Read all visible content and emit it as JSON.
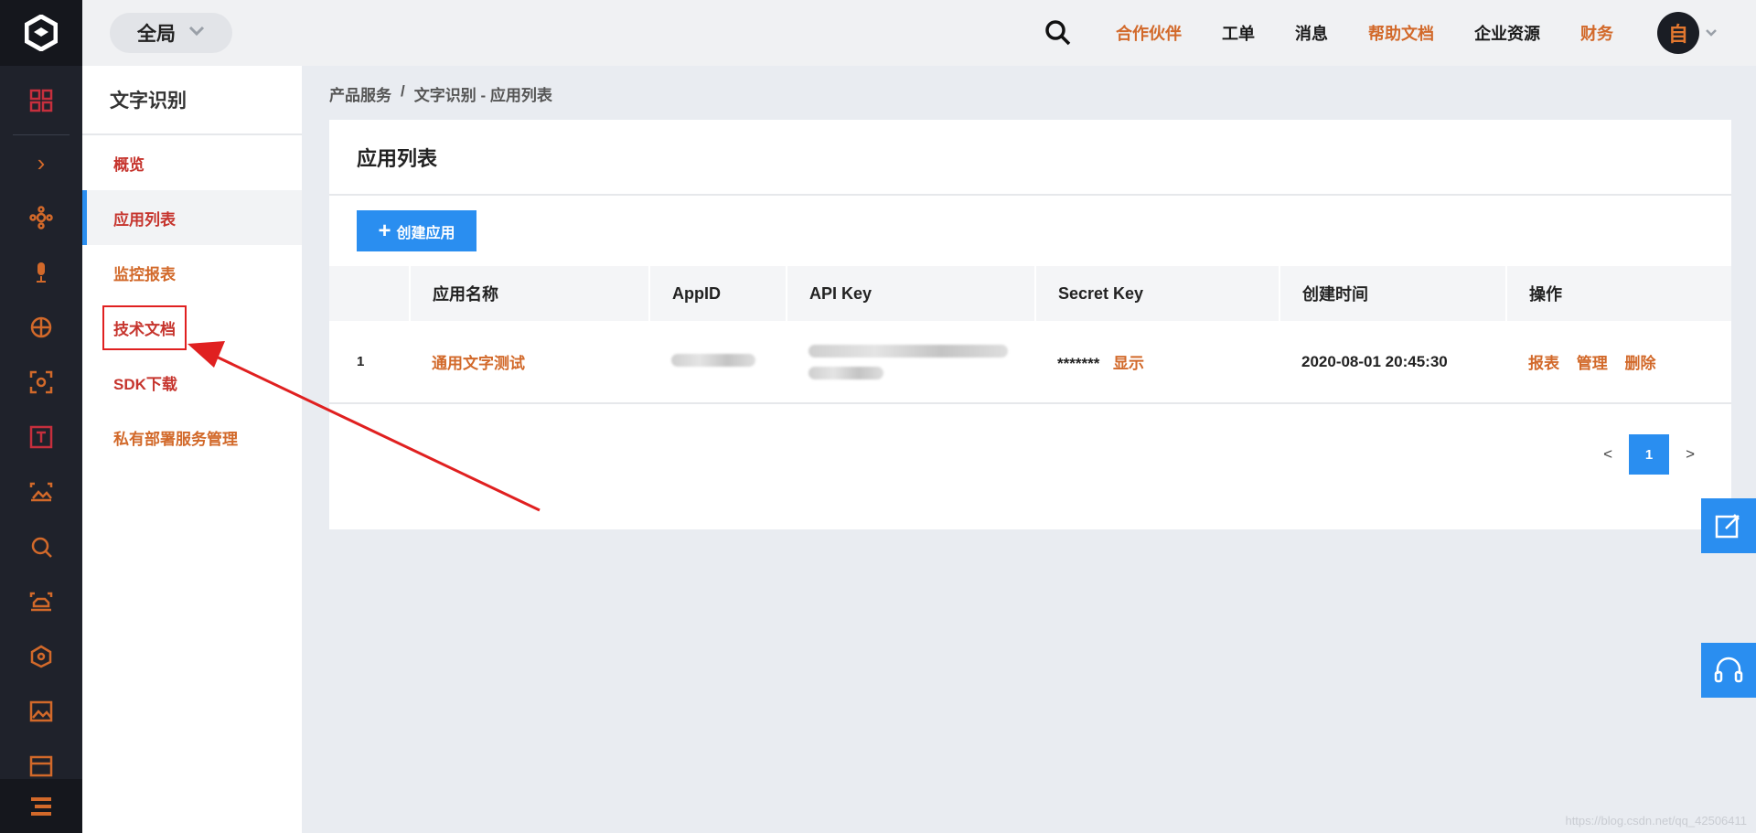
{
  "top_bar": {
    "scope_label": "全局",
    "nav": [
      {
        "label": "合作伙伴",
        "color": "#d2692a"
      },
      {
        "label": "工单",
        "color": "#1a1a1a"
      },
      {
        "label": "消息",
        "color": "#1a1a1a"
      },
      {
        "label": "帮助文档",
        "color": "#d2692a"
      },
      {
        "label": "企业资源",
        "color": "#1a1a1a"
      },
      {
        "label": "财务",
        "color": "#d2692a"
      }
    ],
    "avatar_char": "自"
  },
  "sidebar": {
    "title": "文字识别",
    "items": [
      {
        "label": "概览"
      },
      {
        "label": "应用列表",
        "active": true
      },
      {
        "label": "监控报表"
      },
      {
        "label": "技术文档",
        "highlighted": true
      },
      {
        "label": "SDK下载"
      },
      {
        "label": "私有部署服务管理"
      }
    ]
  },
  "breadcrumb": {
    "root": "产品服务",
    "separator": "/",
    "current": "文字识别 - 应用列表"
  },
  "panel": {
    "title": "应用列表",
    "create_button": "创建应用",
    "table": {
      "headers": [
        "",
        "应用名称",
        "AppID",
        "API Key",
        "Secret Key",
        "创建时间",
        "操作"
      ],
      "rows": [
        {
          "index": "1",
          "name": "通用文字测试",
          "secret_masked": "*******",
          "secret_show": "显示",
          "created_at": "2020-08-01 20:45:30",
          "actions": [
            "报表",
            "管理",
            "删除"
          ]
        }
      ]
    },
    "pagination": {
      "prev": "<",
      "current": "1",
      "next": ">"
    }
  },
  "watermark": "https://blog.csdn.net/qq_42506411",
  "colors": {
    "accent_blue": "#2a8ef0",
    "link_orange": "#d2692a",
    "link_red": "#c6342d",
    "annotation_red": "#e02020"
  }
}
